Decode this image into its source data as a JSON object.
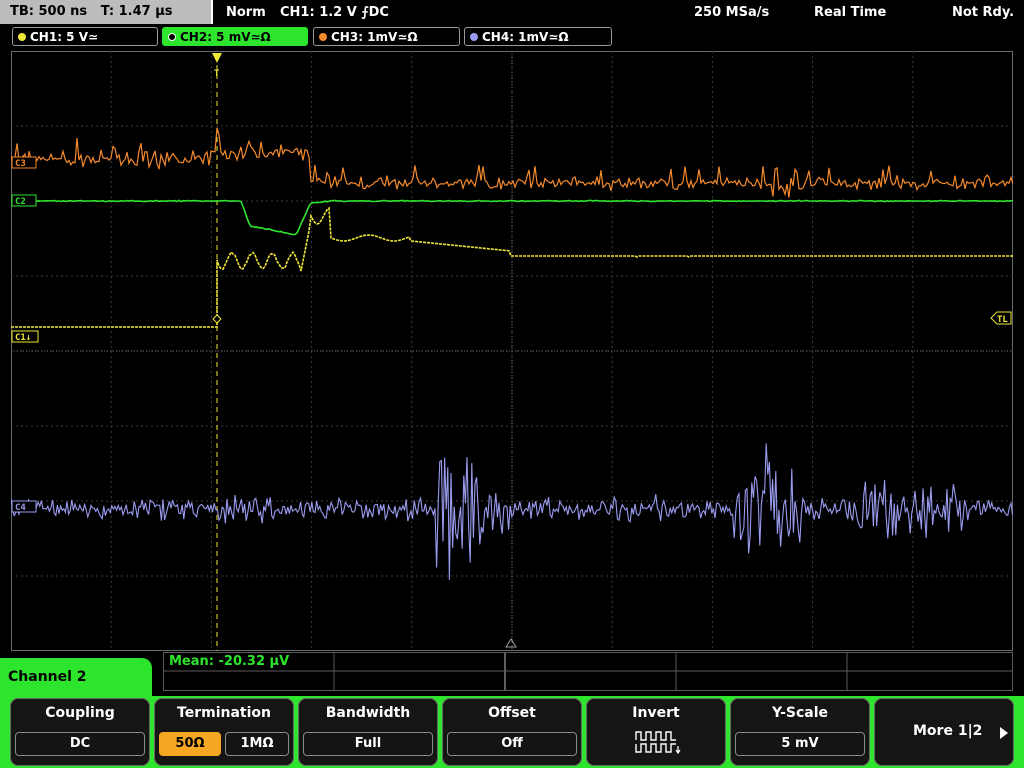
{
  "top": {
    "timebase": "TB: 500 ns",
    "trig_time": "T: 1.47 µs",
    "mode": "Norm",
    "trigger": "CH1: 1.2 V ⨍DC",
    "sample_rate": "250 MSa/s",
    "acq_mode": "Real Time",
    "status": "Not Rdy."
  },
  "channels": [
    {
      "label": "CH1: 5 V≃",
      "color": "#f0e836",
      "active": false
    },
    {
      "label": "CH2: 5 mV≃Ω",
      "color": "#2ee52e",
      "active": true
    },
    {
      "label": "CH3: 1mV≃Ω",
      "color": "#f48a2c",
      "active": false
    },
    {
      "label": "CH4: 1mV≃Ω",
      "color": "#9a9cf0",
      "active": false
    }
  ],
  "markers": {
    "c3": "C3",
    "c2": "C2",
    "c1": "C1↓",
    "c4": "C4",
    "tl": "TL",
    "trig_pos": "T"
  },
  "measure": {
    "text": "Mean: -20.32 µV"
  },
  "menu": {
    "title": "Channel 2",
    "coupling": {
      "title": "Coupling",
      "value": "DC"
    },
    "termination": {
      "title": "Termination",
      "options": [
        "50Ω",
        "1MΩ"
      ],
      "selected": "50Ω"
    },
    "bandwidth": {
      "title": "Bandwidth",
      "value": "Full"
    },
    "offset": {
      "title": "Offset",
      "value": "Off"
    },
    "invert": {
      "title": "Invert"
    },
    "yscale": {
      "title": "Y-Scale",
      "value": "5 mV"
    },
    "more": {
      "label": "More 1|2"
    }
  },
  "colors": {
    "ch1": "#f0e836",
    "ch2": "#2ee52e",
    "ch3": "#f48a2c",
    "ch4": "#9a9cf0",
    "grid": "#4a4a4a",
    "menu_accent": "#2ee52e",
    "selected_option": "#f5a623"
  }
}
